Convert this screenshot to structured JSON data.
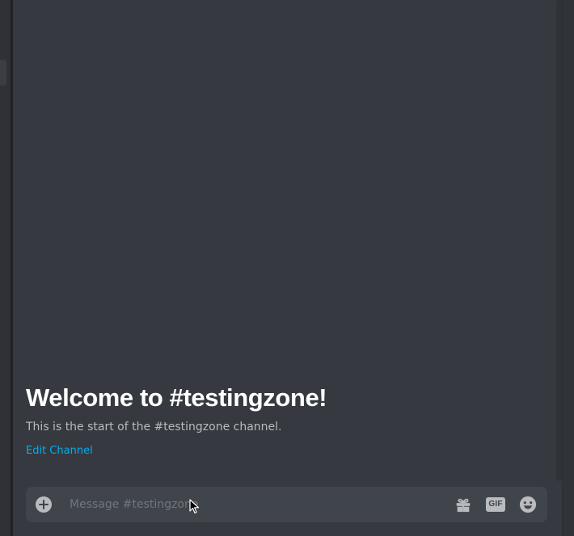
{
  "channel": {
    "welcome_title": "Welcome to #testingzone!",
    "welcome_description": "This is the start of the #testingzone channel.",
    "edit_channel_label": "Edit Channel"
  },
  "composer": {
    "placeholder": "Message #testingzone",
    "value": "",
    "gif_label": "GIF",
    "icons": {
      "attach": "plus-circle-icon",
      "gift": "gift-icon",
      "gif": "gif-icon",
      "emoji": "emoji-icon"
    }
  },
  "colors": {
    "background": "#36393f",
    "composer_bg": "#40444b",
    "link": "#00aff4",
    "title": "#ffffff",
    "muted": "#b9bbbe"
  }
}
